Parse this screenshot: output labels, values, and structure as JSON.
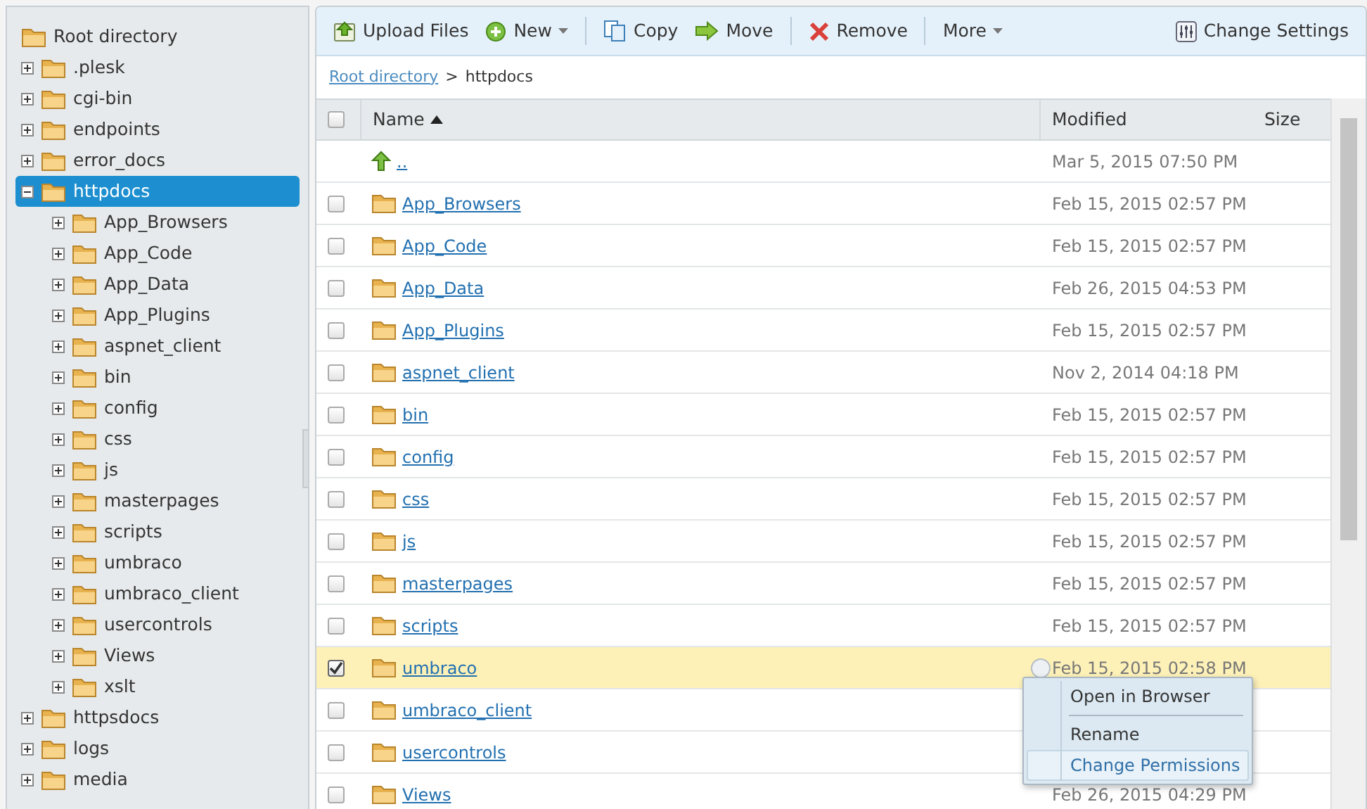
{
  "tree": [
    {
      "label": "Root directory",
      "selected": false,
      "children": [
        {
          "label": ".plesk",
          "expanded": false,
          "selected": false
        },
        {
          "label": "cgi-bin",
          "expanded": false,
          "selected": false
        },
        {
          "label": "endpoints",
          "expanded": false,
          "selected": false
        },
        {
          "label": "error_docs",
          "expanded": false,
          "selected": false
        },
        {
          "label": "httpdocs",
          "expanded": true,
          "selected": true,
          "children": [
            {
              "label": "App_Browsers",
              "expanded": false,
              "selected": false
            },
            {
              "label": "App_Code",
              "expanded": false,
              "selected": false
            },
            {
              "label": "App_Data",
              "expanded": false,
              "selected": false
            },
            {
              "label": "App_Plugins",
              "expanded": false,
              "selected": false
            },
            {
              "label": "aspnet_client",
              "expanded": false,
              "selected": false
            },
            {
              "label": "bin",
              "expanded": false,
              "selected": false
            },
            {
              "label": "config",
              "expanded": false,
              "selected": false
            },
            {
              "label": "css",
              "expanded": false,
              "selected": false
            },
            {
              "label": "js",
              "expanded": false,
              "selected": false
            },
            {
              "label": "masterpages",
              "expanded": false,
              "selected": false
            },
            {
              "label": "scripts",
              "expanded": false,
              "selected": false
            },
            {
              "label": "umbraco",
              "expanded": false,
              "selected": false
            },
            {
              "label": "umbraco_client",
              "expanded": false,
              "selected": false
            },
            {
              "label": "usercontrols",
              "expanded": false,
              "selected": false
            },
            {
              "label": "Views",
              "expanded": false,
              "selected": false
            },
            {
              "label": "xslt",
              "expanded": false,
              "selected": false
            }
          ]
        },
        {
          "label": "httpsdocs",
          "expanded": false,
          "selected": false
        },
        {
          "label": "logs",
          "expanded": false,
          "selected": false
        },
        {
          "label": "media",
          "expanded": false,
          "selected": false
        }
      ]
    }
  ],
  "toolbar": {
    "groups": [
      [
        {
          "label": "Upload Files",
          "has_menu": false
        },
        {
          "label": "New",
          "has_menu": true
        }
      ],
      [
        {
          "label": "Copy",
          "has_menu": false
        },
        {
          "label": "Move",
          "has_menu": false
        }
      ],
      [
        {
          "label": "Remove",
          "has_menu": false
        }
      ],
      [
        {
          "label": "More",
          "has_menu": true
        }
      ]
    ],
    "right": {
      "label": "Change Settings"
    }
  },
  "breadcrumb": [
    {
      "label": "Root directory",
      "kind": "link"
    },
    {
      "label": ">",
      "kind": "sep"
    },
    {
      "label": "httpdocs",
      "kind": "current"
    }
  ],
  "table": {
    "select_all_checked": false,
    "columns": [
      {
        "label": "Name",
        "sorted": true
      },
      {
        "label": "Modified",
        "sorted": false
      },
      {
        "label": "Size",
        "sorted": false
      }
    ],
    "rows": [
      {
        "kind": "parent",
        "name": "..",
        "modified": "Mar 5, 2015 07:50 PM",
        "selected": false
      },
      {
        "kind": "folder",
        "name": "App_Browsers",
        "modified": "Feb 15, 2015 02:57 PM",
        "checked": false,
        "selected": false
      },
      {
        "kind": "folder",
        "name": "App_Code",
        "modified": "Feb 15, 2015 02:57 PM",
        "checked": false,
        "selected": false
      },
      {
        "kind": "folder",
        "name": "App_Data",
        "modified": "Feb 26, 2015 04:53 PM",
        "checked": false,
        "selected": false
      },
      {
        "kind": "folder",
        "name": "App_Plugins",
        "modified": "Feb 15, 2015 02:57 PM",
        "checked": false,
        "selected": false
      },
      {
        "kind": "folder",
        "name": "aspnet_client",
        "modified": "Nov 2, 2014 04:18 PM",
        "checked": false,
        "selected": false
      },
      {
        "kind": "folder",
        "name": "bin",
        "modified": "Feb 15, 2015 02:57 PM",
        "checked": false,
        "selected": false
      },
      {
        "kind": "folder",
        "name": "config",
        "modified": "Feb 15, 2015 02:57 PM",
        "checked": false,
        "selected": false
      },
      {
        "kind": "folder",
        "name": "css",
        "modified": "Feb 15, 2015 02:57 PM",
        "checked": false,
        "selected": false
      },
      {
        "kind": "folder",
        "name": "js",
        "modified": "Feb 15, 2015 02:57 PM",
        "checked": false,
        "selected": false
      },
      {
        "kind": "folder",
        "name": "masterpages",
        "modified": "Feb 15, 2015 02:57 PM",
        "checked": false,
        "selected": false
      },
      {
        "kind": "folder",
        "name": "scripts",
        "modified": "Feb 15, 2015 02:57 PM",
        "checked": false,
        "selected": false
      },
      {
        "kind": "folder",
        "name": "umbraco",
        "modified": "Feb 15, 2015 02:58 PM",
        "checked": true,
        "selected": true
      },
      {
        "kind": "folder",
        "name": "umbraco_client",
        "checked": false,
        "selected": false
      },
      {
        "kind": "folder",
        "name": "usercontrols",
        "checked": false,
        "selected": false
      },
      {
        "kind": "folder",
        "name": "Views",
        "modified": "Feb 26, 2015 04:29 PM",
        "checked": false,
        "selected": false
      }
    ]
  },
  "context_menu": {
    "items": [
      {
        "label": "Open in Browser",
        "selected": false
      },
      {
        "label": "Rename",
        "selected": false
      },
      {
        "label": "Change Permissions",
        "selected": true
      }
    ]
  }
}
